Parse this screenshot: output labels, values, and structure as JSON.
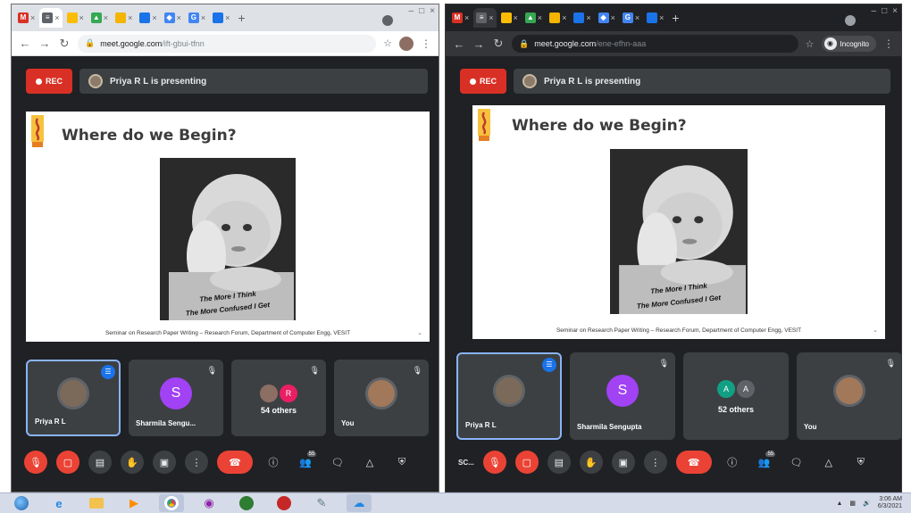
{
  "left_window": {
    "tabs": [
      {
        "icon": "gmail-icon",
        "color": "#d93025",
        "glyph": "M",
        "active": false
      },
      {
        "icon": "meet-icon",
        "color": "#5f6368",
        "glyph": "≡",
        "active": true
      },
      {
        "icon": "docs-icon",
        "color": "#fbbc04",
        "glyph": "",
        "active": false
      },
      {
        "icon": "drive-icon",
        "color": "#34a853",
        "glyph": "▲",
        "active": false
      },
      {
        "icon": "slides-icon",
        "color": "#f4b400",
        "glyph": "",
        "active": false
      },
      {
        "icon": "classroom-icon",
        "color": "#1a73e8",
        "glyph": "",
        "active": false
      },
      {
        "icon": "site-icon",
        "color": "#4285f4",
        "glyph": "◆",
        "active": false
      },
      {
        "icon": "google-icon",
        "color": "#4285f4",
        "glyph": "G",
        "active": false
      },
      {
        "icon": "calendar-icon",
        "color": "#1a73e8",
        "glyph": "",
        "active": false
      }
    ],
    "url_host": "meet.google.com",
    "url_path": "/ift-gbui-tfnn",
    "rec_label": "REC",
    "presenting_label": "Priya R L is presenting",
    "slide": {
      "title": "Where do we Begin?",
      "caption_line1": "The More I Think",
      "caption_line2": "The More Confused I Get",
      "footer": "Seminar on Research Paper Writing – Research Forum, Department of Computer Engg, VESIT"
    },
    "tiles": [
      {
        "type": "photo",
        "name": "Priya R L",
        "speaking": true
      },
      {
        "type": "letter",
        "letter": "S",
        "name": "Sharmila Sengu...",
        "speaking": false
      },
      {
        "type": "group",
        "letters": [
          "",
          "R"
        ],
        "others": "54 others",
        "name": "",
        "speaking": false
      },
      {
        "type": "photo",
        "name": "You",
        "speaking": false
      }
    ],
    "participants_badge": "55"
  },
  "right_window": {
    "url_host": "meet.google.com",
    "url_path": "/ene-efhn-aaa",
    "incognito_label": "Incognito",
    "rec_label": "REC",
    "presenting_label": "Priya R L is presenting",
    "slide": {
      "title": "Where do we Begin?",
      "caption_line1": "The More I Think",
      "caption_line2": "The More Confused I Get",
      "footer": "Seminar on Research Paper Writing – Research Forum, Department of Computer Engg, VESIT"
    },
    "tiles": [
      {
        "type": "photo",
        "name": "Priya R L",
        "speaking": true
      },
      {
        "type": "letter",
        "letter": "S",
        "name": "Sharmila Sengupta",
        "speaking": false
      },
      {
        "type": "group",
        "letters": [
          "A",
          "A"
        ],
        "others": "52 others",
        "name": "",
        "speaking": false
      },
      {
        "type": "photo",
        "name": "You",
        "speaking": false
      }
    ],
    "sc_label": "SC...",
    "participants_badge": "55"
  },
  "taskbar": {
    "apps": [
      "start-button",
      "ie-icon",
      "explorer-icon",
      "media-icon",
      "chrome-icon",
      "paint-icon",
      "vlc-icon",
      "chrome-alt-icon",
      "notepad-icon",
      "onedrive-icon"
    ],
    "time": "3:06 AM",
    "date": "6/3/2021"
  }
}
